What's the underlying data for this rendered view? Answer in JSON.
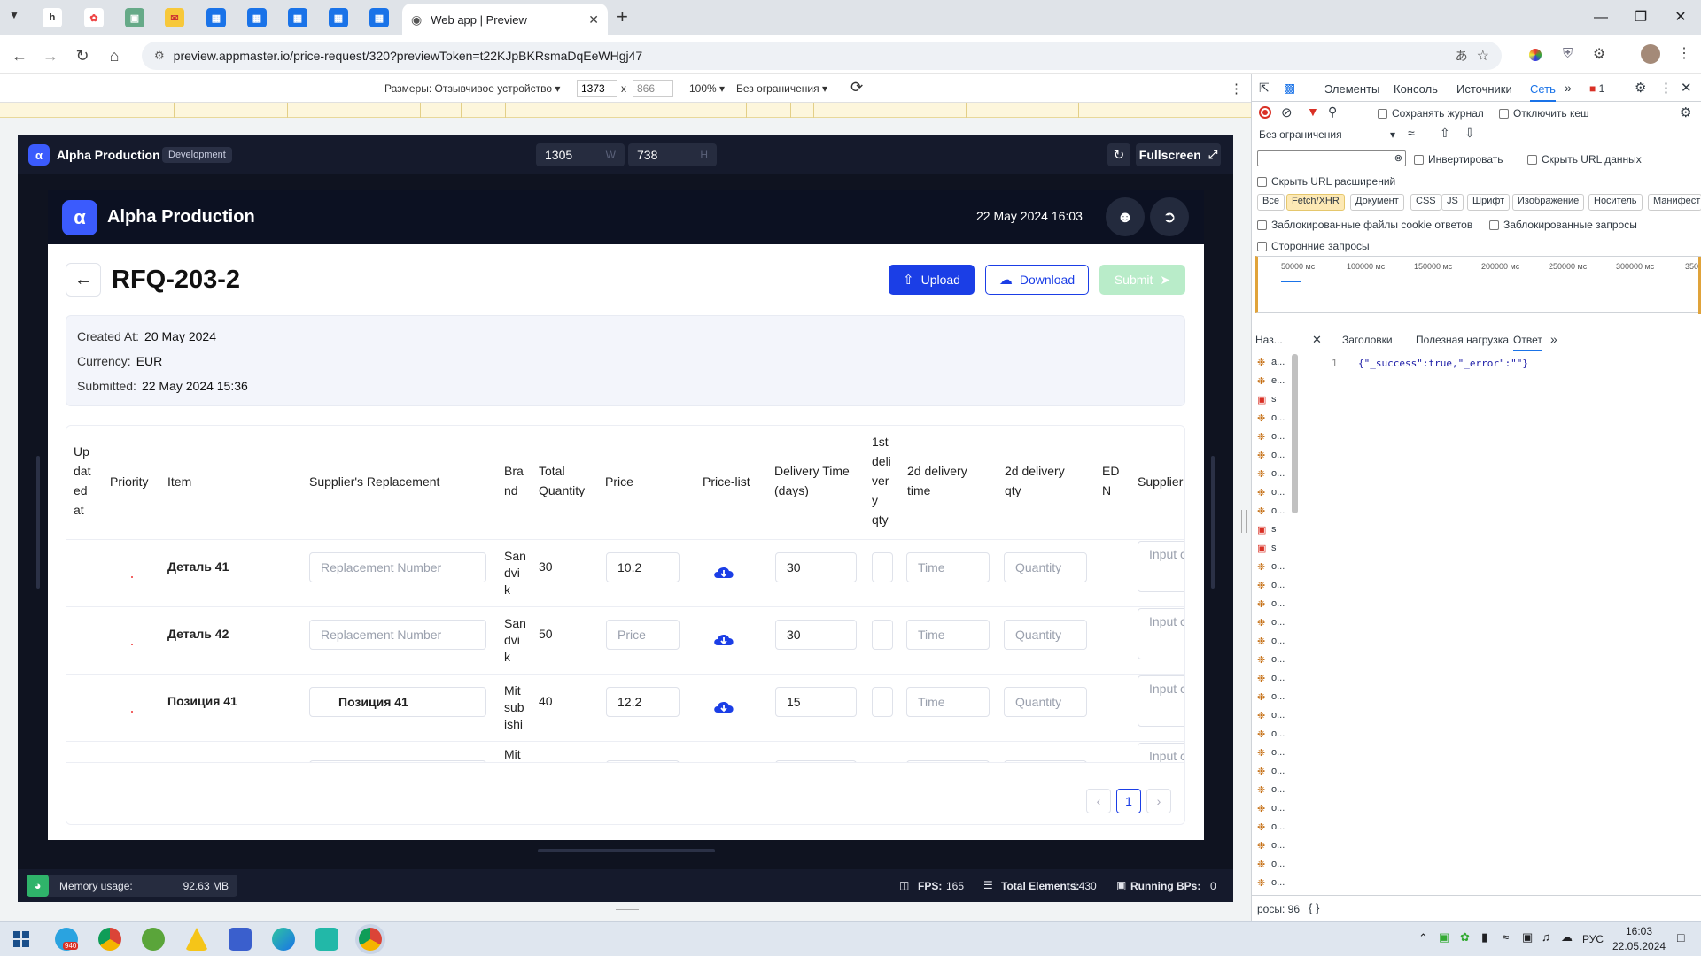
{
  "browser": {
    "active_tab_title": "Web app | Preview",
    "url": "preview.appmaster.io/price-request/320?previewToken=t22KJpBKRsmaDqEeWHgj47",
    "new_tab": "+"
  },
  "device_toolbar": {
    "dimensions_label": "Размеры: Отзывчивое устройство",
    "width": "1373",
    "height": "866",
    "x": "x",
    "zoom": "100%",
    "throttle": "Без ограничения"
  },
  "am_preview": {
    "app_name": "Alpha Production",
    "env_badge": "Development",
    "width": "1305",
    "width_unit": "W",
    "height": "738",
    "height_unit": "H",
    "fullscreen": "Fullscreen",
    "memory_label": "Memory usage:",
    "memory_value": "92.63 MB",
    "fps_label": "FPS:",
    "fps_value": "165",
    "elements_label": "Total Elements:",
    "elements_value": "1430",
    "bps_label": "Running BPs:",
    "bps_value": "0"
  },
  "app": {
    "brand": "Alpha Production",
    "datetime": "22 May 2024 16:03",
    "rfq_title": "RFQ-203-2",
    "upload_label": "Upload",
    "download_label": "Download",
    "submit_label": "Submit",
    "info": {
      "created_label": "Created At:",
      "created_value": "20 May 2024",
      "currency_label": "Currency:",
      "currency_value": "EUR",
      "submitted_label": "Submitted:",
      "submitted_value": "22 May 2024 15:36"
    },
    "columns": {
      "updated": [
        "Up",
        "dat",
        "ed",
        "at"
      ],
      "priority": "Priority",
      "item": "Item",
      "replacement": "Supplier's Replacement",
      "brand": [
        "Bra",
        "nd"
      ],
      "total_qty": [
        "Total",
        "Quantity"
      ],
      "price": "Price",
      "price_list": "Price-list",
      "delivery": [
        "Delivery Time",
        "(days)"
      ],
      "first_qty": [
        "1st",
        "deli",
        "ver",
        "y",
        "qty"
      ],
      "d2_time": [
        "2d delivery",
        "time"
      ],
      "d2_qty": [
        "2d delivery",
        "qty"
      ],
      "edn": [
        "ED",
        "N"
      ],
      "supplier": "Supplier"
    },
    "rows": [
      {
        "item": "Деталь 41",
        "replacement": "Replacement Number",
        "brand": [
          "San",
          "dvi",
          "k"
        ],
        "qty": "30",
        "price": "10.2",
        "delivery": "30",
        "time": "Time",
        "quantity": "Quantity",
        "supplier": "Input c"
      },
      {
        "item": "Деталь 42",
        "replacement": "Replacement Number",
        "brand": [
          "San",
          "dvi",
          "k"
        ],
        "qty": "50",
        "price": "Price",
        "delivery": "30",
        "time": "Time",
        "quantity": "Quantity",
        "supplier": "Input c"
      },
      {
        "item": "Позиция 41",
        "replacement": "Позиция 41",
        "brand": [
          "Mit",
          "sub",
          "ishi"
        ],
        "qty": "40",
        "price": "12.2",
        "delivery": "15",
        "time": "Time",
        "quantity": "Quantity",
        "supplier": "Input c"
      },
      {
        "brand": [
          "Mit"
        ],
        "supplier": "Input c"
      }
    ],
    "page": "1"
  },
  "devtools": {
    "tabs": [
      "Элементы",
      "Консоль",
      "Источники",
      "Сеть"
    ],
    "error_count": "1",
    "preserve_log": "Сохранять журнал",
    "disable_cache": "Отключить кеш",
    "throttle": "Без ограничения",
    "invert": "Инвертировать",
    "hide_data_urls": "Скрыть URL данных",
    "hide_ext_urls": "Скрыть URL расширений",
    "filters": [
      "Все",
      "Fetch/XHR",
      "Документ",
      "CSS",
      "JS",
      "Шрифт",
      "Изображение",
      "Носитель",
      "Манифест"
    ],
    "blocked_cookies": "Заблокированные файлы cookie ответов",
    "blocked_requests": "Заблокированные запросы",
    "third_party": "Сторонние запросы",
    "timeline": [
      "50000 мс",
      "100000 мс",
      "150000 мс",
      "200000 мс",
      "250000 мс",
      "300000 мс",
      "350("
    ],
    "name_col": "Наз...",
    "detail_tabs": [
      "Заголовки",
      "Полезная нагрузка",
      "Ответ"
    ],
    "response_line_no": "1",
    "response_text": "{\"_success\":true,\"_error\":\"\"}",
    "requests": [
      "a...",
      "e...",
      "s",
      "o...",
      "o...",
      "o...",
      "o...",
      "o...",
      "o...",
      "s",
      "s",
      "o...",
      "o...",
      "o...",
      "o...",
      "o...",
      "o...",
      "o...",
      "o...",
      "o...",
      "o...",
      "o...",
      "o...",
      "o...",
      "o...",
      "o...",
      "o...",
      "o...",
      "o..."
    ],
    "status_count": "росы: 96"
  },
  "taskbar": {
    "lang": "РУС",
    "time": "16:03",
    "date": "22.05.2024",
    "telegram_badge": "940"
  }
}
